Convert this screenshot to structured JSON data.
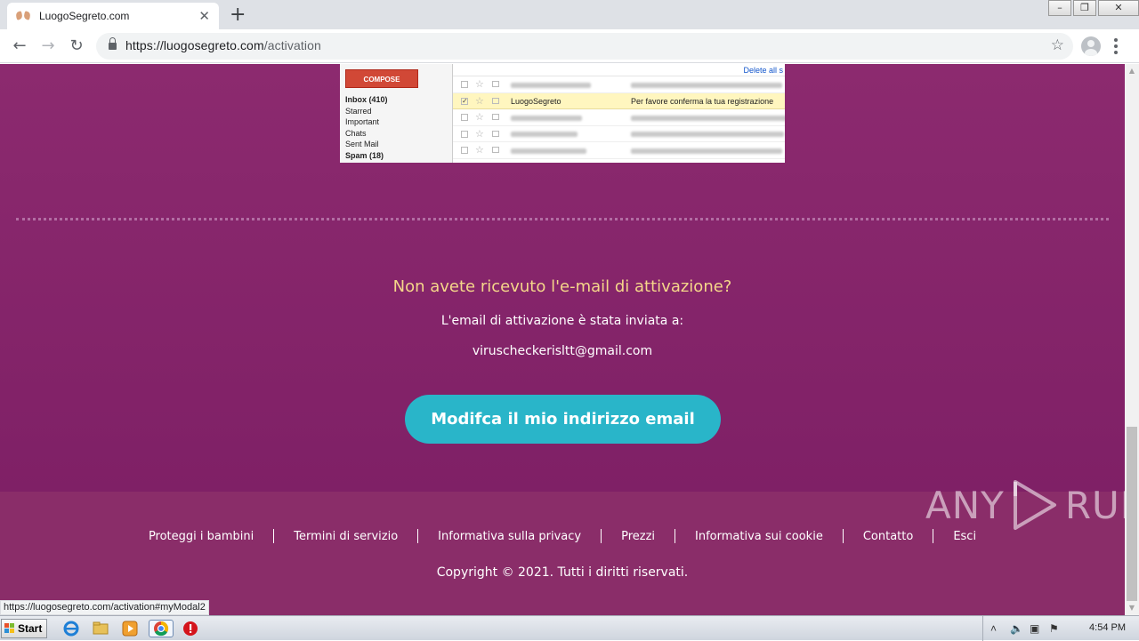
{
  "browser": {
    "tab_title": "LuogoSegreto.com",
    "tab_close": "✕",
    "new_tab": "+",
    "url_host": "https://luogosegreto.com",
    "url_path": "/activation",
    "status_url": "https://luogosegreto.com/activation#myModal2"
  },
  "gmail_screenshot": {
    "compose": "COMPOSE",
    "folders": [
      "Inbox (410)",
      "Starred",
      "Important",
      "Chats",
      "Sent Mail",
      "Spam (18)"
    ],
    "top_action": "Delete all s",
    "highlight_row": {
      "from": "LuogoSegreto",
      "subject": "Per favore conferma la tua registrazione"
    }
  },
  "activation": {
    "not_received": "Non avete ricevuto l'e-mail di attivazione?",
    "sent_to_label": "L'email di attivazione è stata inviata a:",
    "email": "viruscheckerisltt@gmail.com",
    "change_email_button": "Modifca il mio indirizzo email"
  },
  "footer": {
    "links": [
      "Proteggi i bambini",
      "Termini di servizio",
      "Informativa sulla privacy",
      "Prezzi",
      "Informativa sui cookie",
      "Contatto",
      "Esci"
    ],
    "copyright": "Copyright © 2021. Tutti i diritti riservati."
  },
  "watermark": {
    "left": "ANY",
    "right": "RUN"
  },
  "taskbar": {
    "start": "Start",
    "time": "4:54 PM"
  },
  "colors": {
    "page_bg": "#8c2a6f",
    "footer_bg": "#8a2d69",
    "heading": "#f5d78a",
    "button": "#29b5c9"
  }
}
